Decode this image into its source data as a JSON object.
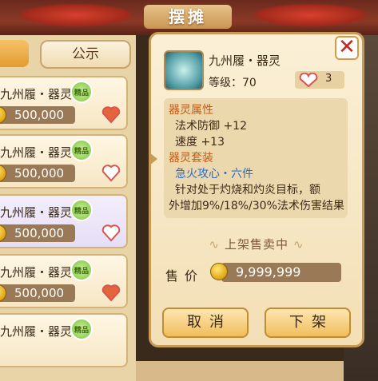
{
  "header": {
    "title": "摆摊"
  },
  "left_panel": {
    "tab_public": "公示",
    "items": [
      {
        "name": "九州履・器灵",
        "badge": "精品",
        "price": "500,000",
        "liked": true
      },
      {
        "name": "九州履・器灵",
        "badge": "精品",
        "price": "500,000",
        "liked": false
      },
      {
        "name": "九州履・器灵",
        "badge": "精品",
        "price": "500,000",
        "liked": false,
        "selected": true
      },
      {
        "name": "九州履・器灵",
        "badge": "精品",
        "price": "500,000",
        "liked": true
      },
      {
        "name": "九州履・器灵",
        "badge": "精品",
        "price": "",
        "liked": false
      }
    ]
  },
  "modal": {
    "item_name": "九州履・器灵",
    "level_label": "等级：70",
    "likes": "3",
    "attr_title": "器灵属性",
    "attr_1": "法术防御  +12",
    "attr_2": "速度  +13",
    "suit_title": "器灵套装",
    "suit_name": "急火攻心・六件",
    "desc_1": "针对处于灼烧和灼炎目标，额",
    "desc_2": "外增加9%/18%/30%法术伤害结果",
    "status": "上架售卖中",
    "price_label": "售价",
    "price_value": "9,999,999",
    "cancel_label": "取消",
    "list_label": "下架"
  },
  "colors": {
    "accent": "#c79a56",
    "price_bg": "#9a7a56",
    "heart": "#d9534f",
    "suit_link": "#2a6cc8"
  }
}
